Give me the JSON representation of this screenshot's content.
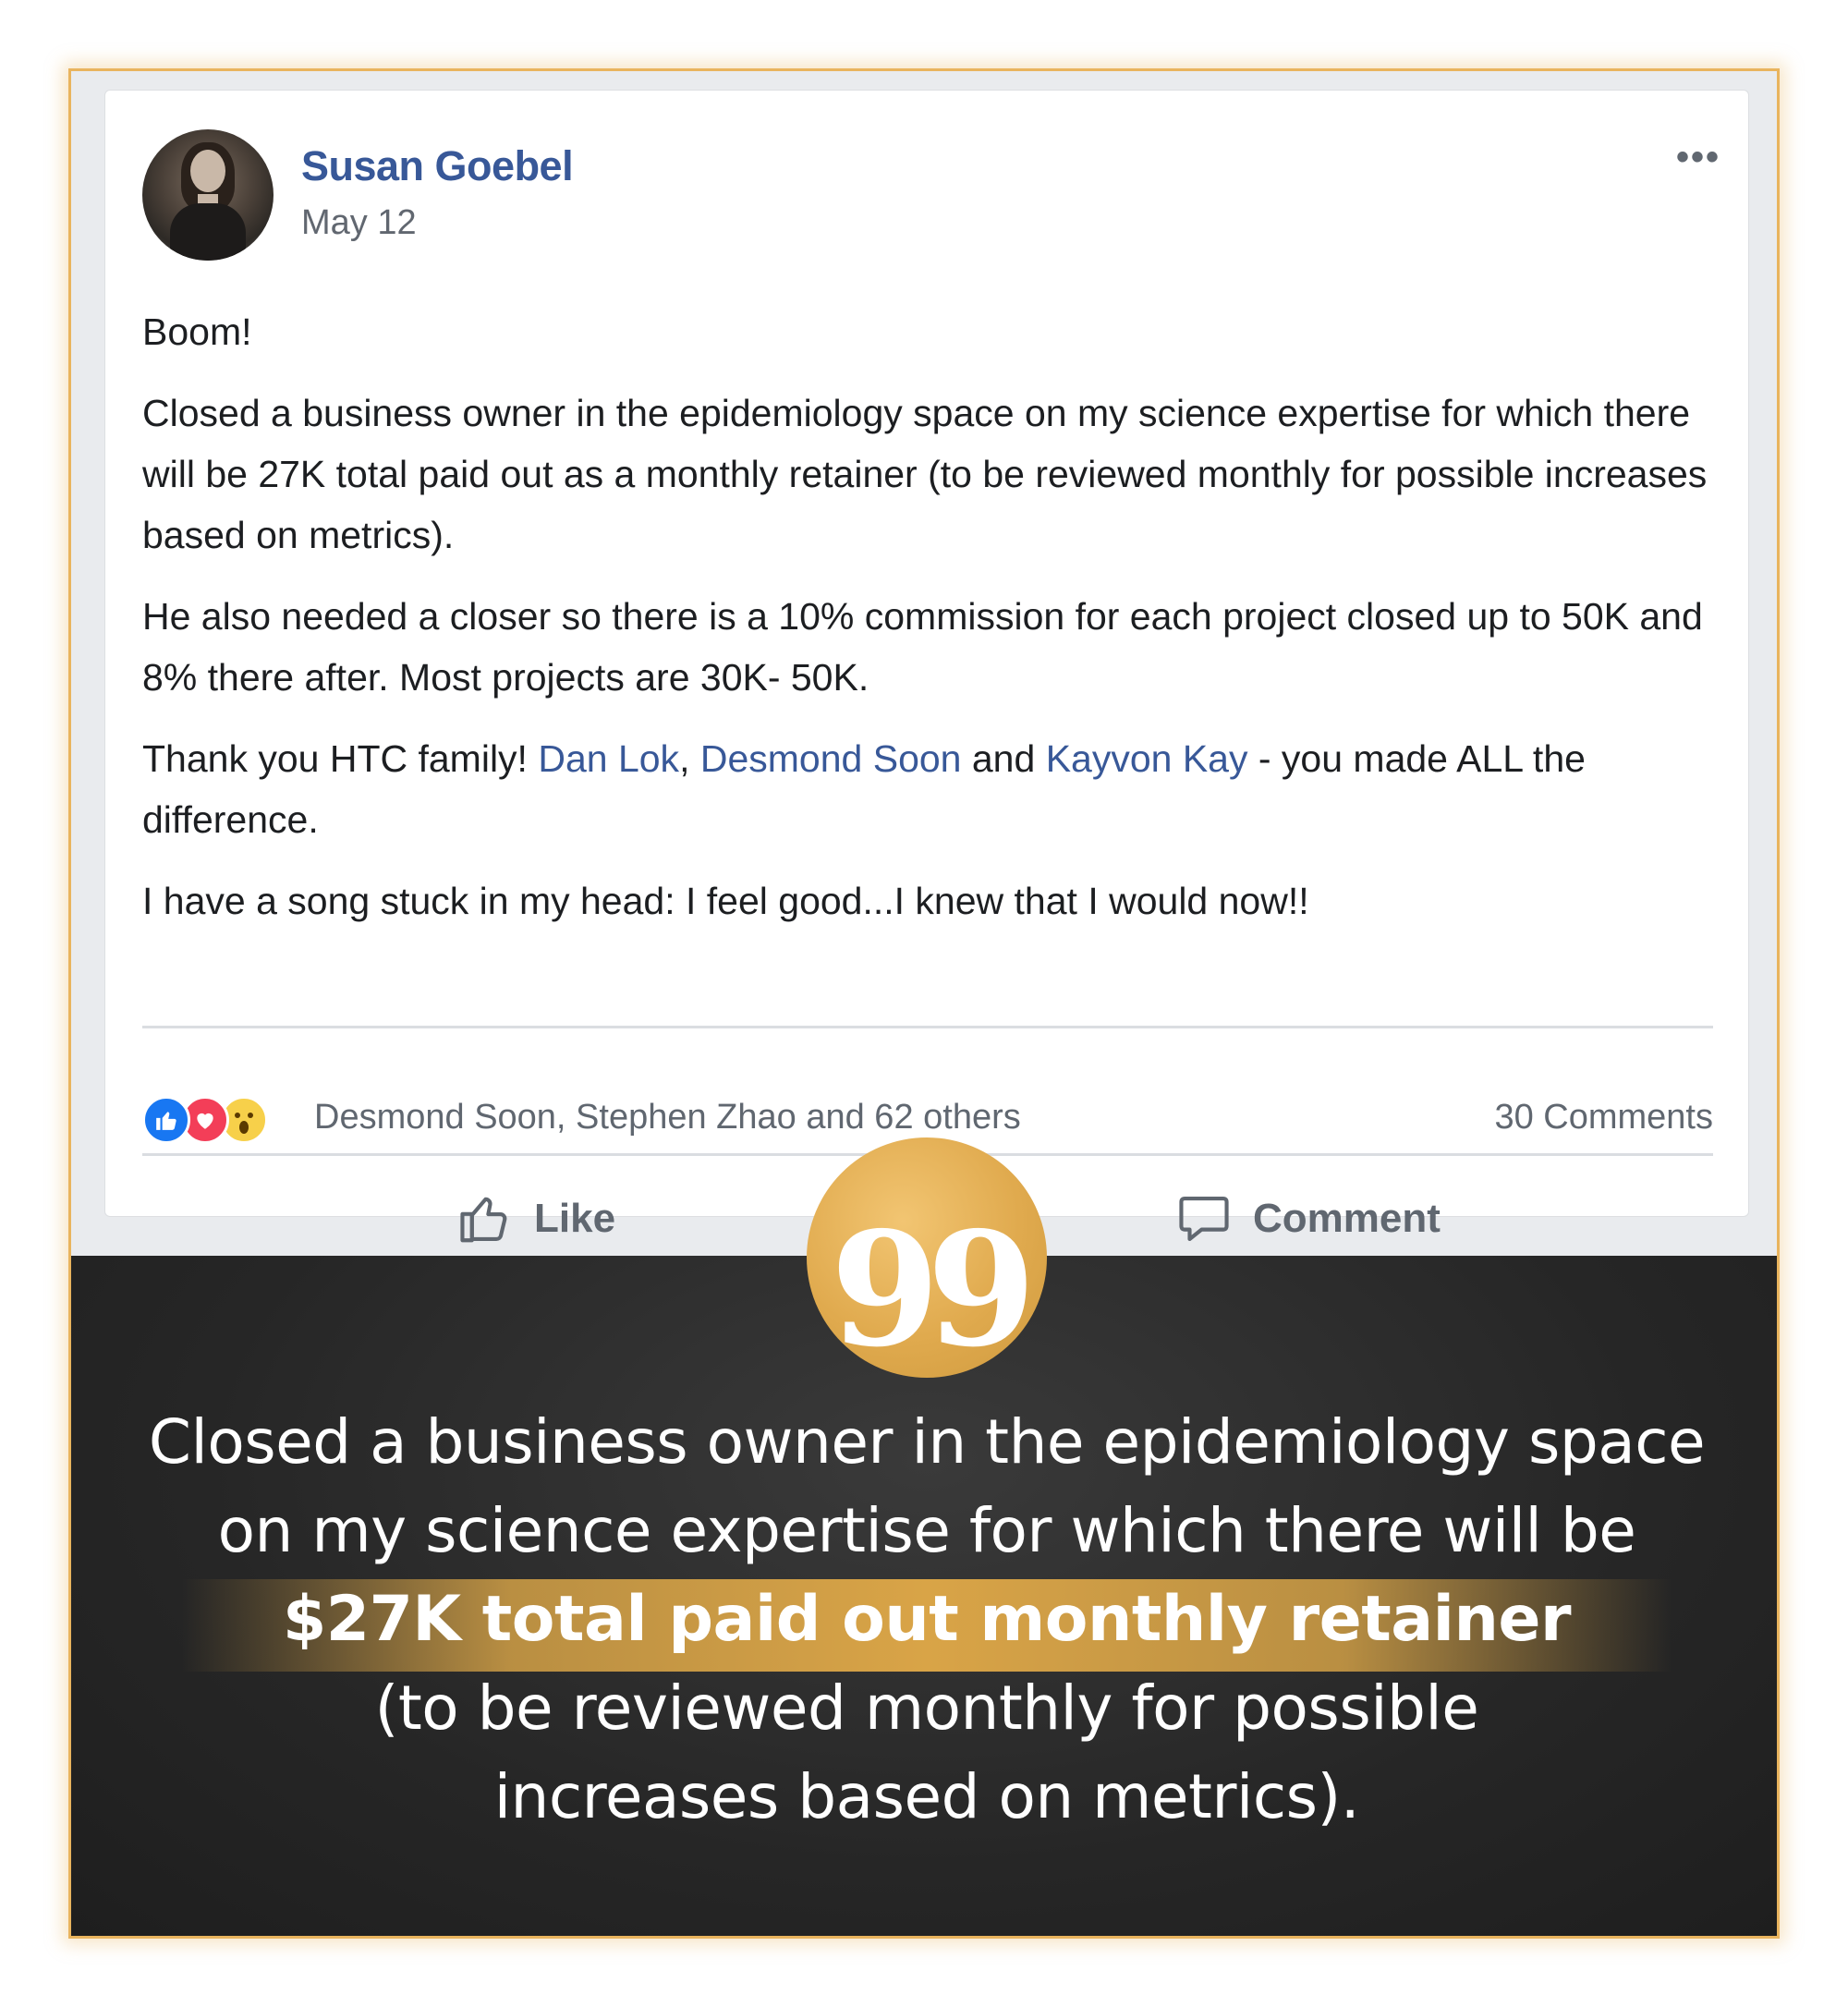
{
  "post": {
    "author": "Susan Goebel",
    "date": "May 12",
    "more_icon": "•••",
    "paragraphs": {
      "p1": "Boom!",
      "p2": "Closed a business owner in the epidemiology space on my science expertise for which there will be 27K total paid out as a monthly retainer (to be reviewed monthly for possible increases based on metrics).",
      "p3": "He also needed a closer so there is a 10% commission for each project closed up to 50K and 8% there after. Most projects are 30K- 50K.",
      "p4_start": "Thank you HTC family! ",
      "p4_link1": "Dan Lok",
      "p4_sep1": ", ",
      "p4_link2": "Desmond Soon",
      "p4_sep2": " and ",
      "p4_link3": "Kayvon Kay",
      "p4_end": " - you made ALL the difference.",
      "p5": "I have a song stuck in my head: I feel good...I knew that I would now!!"
    },
    "reactions": {
      "icons": [
        "like-icon",
        "love-icon",
        "wow-icon"
      ],
      "names": "Desmond Soon, Stephen Zhao and 62 others",
      "comments": "30 Comments"
    },
    "actions": {
      "like": "Like",
      "comment": "Comment"
    }
  },
  "quote": {
    "badge": "99",
    "line1": "Closed a business owner in the epidemiology space",
    "line2": "on my science expertise for which there will be",
    "highlight": "$27K total paid out monthly retainer",
    "line3": "(to be reviewed monthly for possible",
    "line4": "increases based on metrics)."
  },
  "colors": {
    "link": "#385898",
    "accent_gold": "#e0aa4e",
    "frame_border": "#e9b45e",
    "dark_bg": "#262626"
  }
}
